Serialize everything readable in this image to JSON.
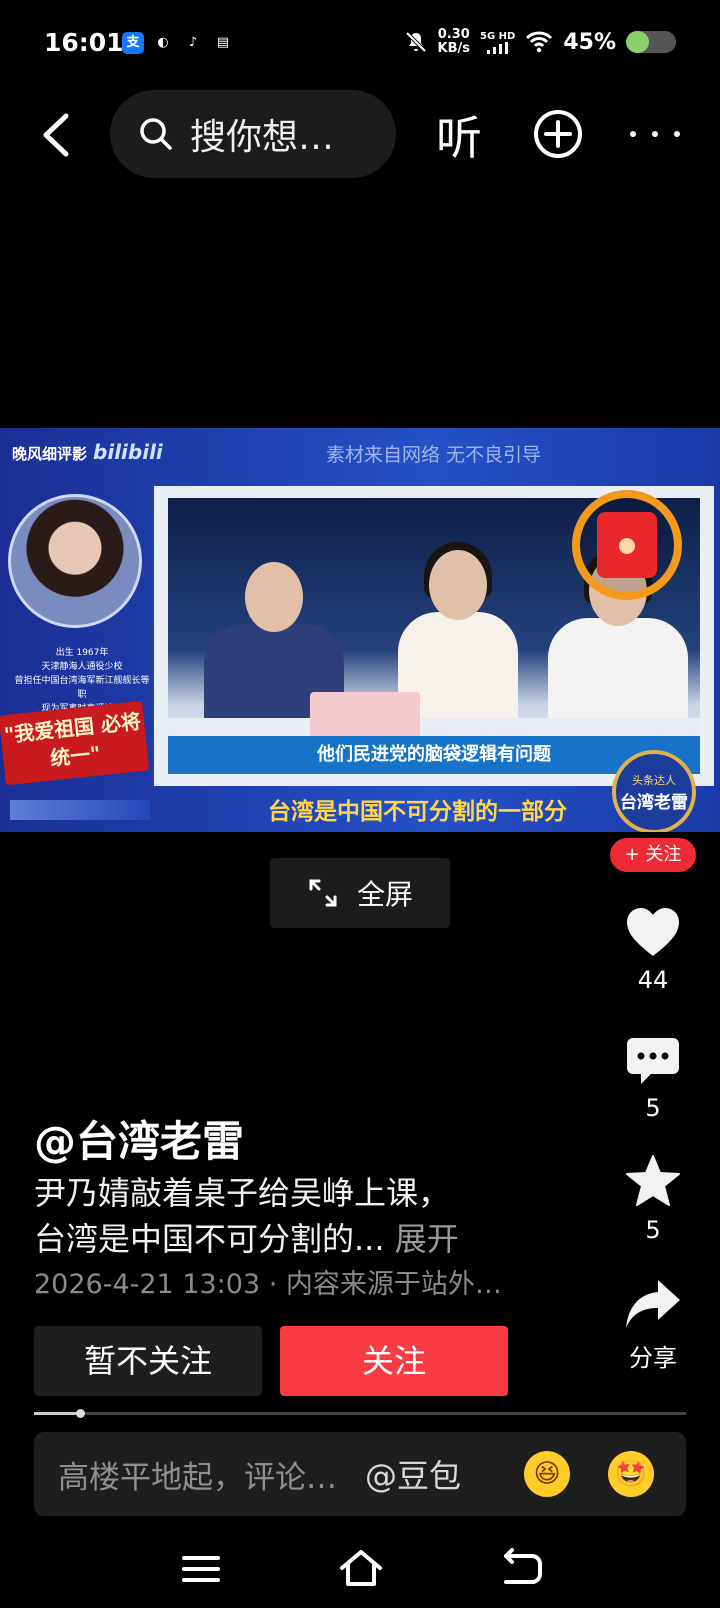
{
  "status_bar": {
    "time": "16:01",
    "app_icons": [
      {
        "name": "alipay-icon",
        "glyph": "支",
        "color": "#1677ff"
      },
      {
        "name": "app-swirl-icon",
        "glyph": "◐",
        "color": "#ffffff"
      },
      {
        "name": "tiktok-icon",
        "glyph": "♪",
        "color": "#ffffff"
      },
      {
        "name": "wallet-icon",
        "glyph": "▤",
        "color": "#ffffff"
      }
    ],
    "net_speed_value": "0.30",
    "net_speed_unit": "KB/s",
    "network_type": "5G HD",
    "battery_percent": "45%",
    "battery_level": 0.45
  },
  "top_nav": {
    "search_text": "搜你想…",
    "listen_label": "听"
  },
  "video": {
    "channel": "晚风细评影",
    "platform": "bilibili",
    "source_note": "素材来自网络 无不良引导",
    "bio_lines": [
      "出生 1967年",
      "天津静海人通役少校",
      "曾担任中国台湾海军新江舰舰长等职",
      "现为军事时事评论员"
    ],
    "slogan": "\"我爱祖国 必将统一\"",
    "caption": "他们民进党的脑袋逻辑有问题",
    "banner": "台湾是中国不可分割的一部分",
    "badge_top": "头条达人",
    "badge_main": "台湾老雷"
  },
  "follow_chip": "+ 关注",
  "fullscreen_label": "全屏",
  "rail": {
    "likes": "44",
    "comments": "5",
    "favorites": "5",
    "share_label": "分享"
  },
  "post": {
    "author": "@台湾老雷",
    "desc_line1": "尹乃婧敲着桌子给吴峥上课，",
    "desc_line2": "台湾是中国不可分割的...",
    "expand_label": "展开",
    "meta": "2026-4-21 13:03 · 内容来源于站外…",
    "unfollow_label": "暂不关注",
    "follow_label": "关注"
  },
  "progress_fraction": 0.07,
  "comment": {
    "placeholder": "高楼平地起，评论…",
    "mention": "@豆包",
    "emoji1": "😆",
    "emoji2": "🤩"
  },
  "colors": {
    "accent_red": "#fb3b42",
    "battery_green": "#8bd06a"
  }
}
